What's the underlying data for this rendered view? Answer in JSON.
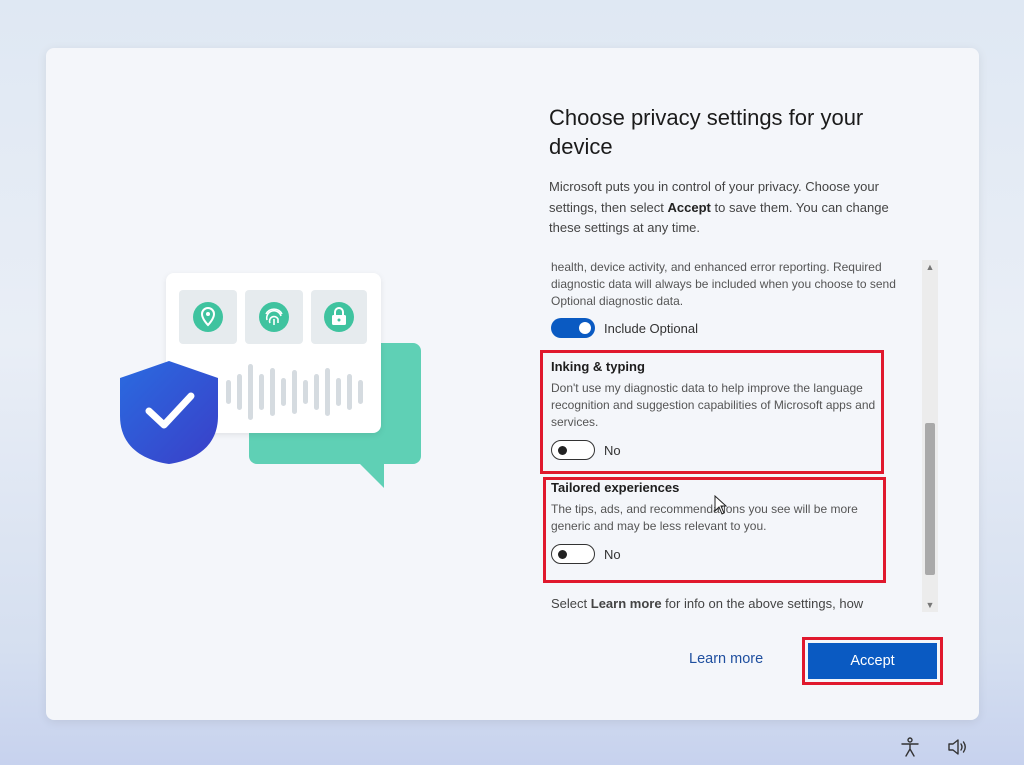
{
  "dialog": {
    "title": "Choose privacy settings for your device",
    "intro_before": "Microsoft puts you in control of your privacy. Choose your settings, then select ",
    "intro_bold": "Accept",
    "intro_after": " to save them. You can change these settings at any time."
  },
  "settings": {
    "diagnostic_tail": "health, device activity, and enhanced error reporting. Required diagnostic data will always be included when you choose to send Optional diagnostic data.",
    "diagnostic_toggle_label": "Include Optional",
    "diagnostic_toggle_state": "on",
    "inking": {
      "title": "Inking & typing",
      "description": "Don't use my diagnostic data to help improve the language recognition and suggestion capabilities of Microsoft apps and services.",
      "toggle_label": "No",
      "toggle_state": "off"
    },
    "tailored": {
      "title": "Tailored experiences",
      "description": "The tips, ads, and recommendations you see will be more generic and may be less relevant to you.",
      "toggle_label": "No",
      "toggle_state": "off"
    },
    "footer_before": "Select ",
    "footer_bold": "Learn more",
    "footer_after": " for info on the above settings, how"
  },
  "buttons": {
    "learn_more": "Learn more",
    "accept": "Accept"
  },
  "icons": {
    "location": "location-pin-icon",
    "fingerprint": "fingerprint-icon",
    "lock": "lock-icon",
    "shield": "shield-check-icon",
    "accessibility": "accessibility-icon",
    "volume": "volume-icon"
  },
  "colors": {
    "accent": "#0a5ac2",
    "highlight": "#e0182d",
    "teal": "#5fd0b5",
    "shield": "#2f4fd6"
  }
}
